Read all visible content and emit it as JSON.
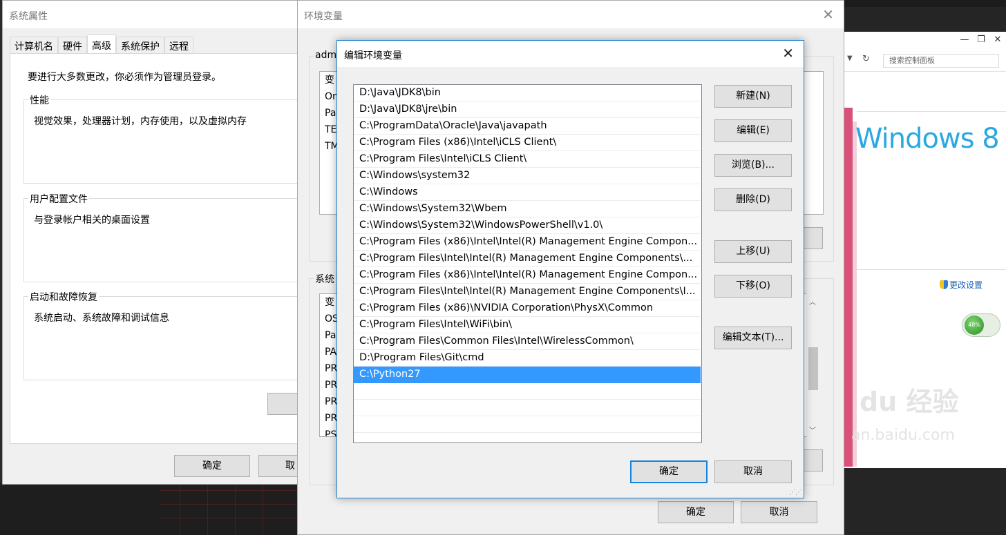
{
  "system_properties": {
    "title": "系统属性",
    "tabs": [
      "计算机名",
      "硬件",
      "高级",
      "系统保护",
      "远程"
    ],
    "active_tab": "高级",
    "admin_note": "要进行大多数更改，你必须作为管理员登录。",
    "groups": [
      {
        "label": "性能",
        "desc": "视觉效果，处理器计划，内存使用，以及虚拟内存"
      },
      {
        "label": "用户配置文件",
        "desc": "与登录帐户相关的桌面设置"
      },
      {
        "label": "启动和故障恢复",
        "desc": "系统启动、系统故障和调试信息"
      }
    ],
    "ok_label": "确定",
    "cancel_label": "取"
  },
  "env_vars": {
    "title": "环境变量",
    "user_group_label": "adm",
    "user_vars": [
      "变",
      "On",
      "Pa",
      "TE",
      "TM"
    ],
    "system_group_label": "系统",
    "system_vars": [
      "变",
      "OS",
      "Pa",
      "PA",
      "PR",
      "PR",
      "PR",
      "PR",
      "PS"
    ],
    "ok_label": "确定",
    "cancel_label": "取消"
  },
  "edit_dialog": {
    "title": "编辑环境变量",
    "paths": [
      "D:\\Java\\JDK8\\bin",
      "D:\\Java\\JDK8\\jre\\bin",
      "C:\\ProgramData\\Oracle\\Java\\javapath",
      "C:\\Program Files (x86)\\Intel\\iCLS Client\\",
      "C:\\Program Files\\Intel\\iCLS Client\\",
      "C:\\Windows\\system32",
      "C:\\Windows",
      "C:\\Windows\\System32\\Wbem",
      "C:\\Windows\\System32\\WindowsPowerShell\\v1.0\\",
      "C:\\Program Files (x86)\\Intel\\Intel(R) Management Engine Compon...",
      "C:\\Program Files\\Intel\\Intel(R) Management Engine Components\\...",
      "C:\\Program Files (x86)\\Intel\\Intel(R) Management Engine Compon...",
      "C:\\Program Files\\Intel\\Intel(R) Management Engine Components\\I...",
      "C:\\Program Files (x86)\\NVIDIA Corporation\\PhysX\\Common",
      "C:\\Program Files\\Intel\\WiFi\\bin\\",
      "C:\\Program Files\\Common Files\\Intel\\WirelessCommon\\",
      "D:\\Program Files\\Git\\cmd",
      "C:\\Python27"
    ],
    "selected_index": 17,
    "buttons": {
      "new": "新建(N)",
      "edit": "编辑(E)",
      "browse": "浏览(B)...",
      "delete": "删除(D)",
      "move_up": "上移(U)",
      "move_down": "下移(O)",
      "edit_text": "编辑文本(T)..."
    },
    "ok_label": "确定",
    "cancel_label": "取消",
    "accent_color": "#3399ff"
  },
  "control_panel": {
    "search_placeholder": "搜索控制面板",
    "brand_text": "Windows 8",
    "change_settings": "更改设置",
    "gauge_value": "48%",
    "watermark": "du 经验",
    "watermark_url": "an.baidu.com"
  }
}
